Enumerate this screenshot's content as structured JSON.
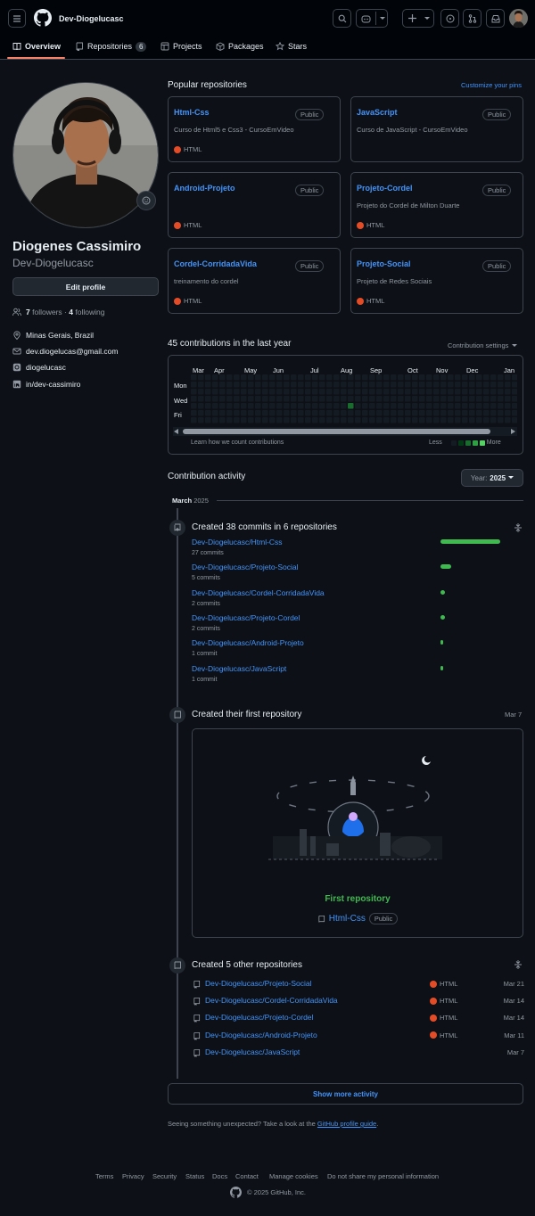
{
  "header": {
    "username": "Dev-Diogelucasc"
  },
  "tabs": [
    {
      "label": "Overview"
    },
    {
      "label": "Repositories",
      "count": "6"
    },
    {
      "label": "Projects"
    },
    {
      "label": "Packages"
    },
    {
      "label": "Stars"
    }
  ],
  "profile": {
    "name": "Diogenes Cassimiro",
    "login": "Dev-Diogelucasc",
    "edit_label": "Edit profile",
    "followers": "7",
    "followers_label": "followers",
    "following": "4",
    "following_label": "following",
    "location": "Minas Gerais, Brazil",
    "email": "dev.diogelucas@gmail.com",
    "instagram": "diogelucasc",
    "linkedin": "in/dev-cassimiro"
  },
  "pinned": {
    "title": "Popular repositories",
    "customize": "Customize your pins",
    "public_label": "Public",
    "items": [
      {
        "name": "Html-Css",
        "desc": "Curso de Html5 e Css3 - CursoEmVideo",
        "lang": "HTML"
      },
      {
        "name": "JavaScript",
        "desc": "Curso de JavaScript - CursoEmVideo",
        "lang": ""
      },
      {
        "name": "Android-Projeto",
        "desc": "",
        "lang": "HTML"
      },
      {
        "name": "Projeto-Cordel",
        "desc": "Projeto do Cordel de Milton Duarte",
        "lang": "HTML"
      },
      {
        "name": "Cordel-CorridadaVida",
        "desc": "treinamento do cordel",
        "lang": "HTML"
      },
      {
        "name": "Projeto-Social",
        "desc": "Projeto de Redes Sociais",
        "lang": "HTML"
      }
    ]
  },
  "contrib": {
    "title": "45 contributions in the last year",
    "settings": "Contribution settings",
    "months": [
      "Mar",
      "Apr",
      "May",
      "Jun",
      "Jul",
      "Aug",
      "Sep",
      "Oct",
      "Nov",
      "Dec",
      "Jan"
    ],
    "days": [
      "Mon",
      "Wed",
      "Fri"
    ],
    "learn": "Learn how we count contributions",
    "less": "Less",
    "more": "More"
  },
  "activity": {
    "title": "Contribution activity",
    "year_label": "Year:",
    "year": "2025",
    "month": "March",
    "month_year": "2025",
    "commits_title": "Created 38 commits in 6 repositories",
    "commits": [
      {
        "repo": "Dev-Diogelucasc/Html-Css",
        "count": "27 commits",
        "share": 0.71
      },
      {
        "repo": "Dev-Diogelucasc/Projeto-Social",
        "count": "5 commits",
        "share": 0.13
      },
      {
        "repo": "Dev-Diogelucasc/Cordel-CorridadaVida",
        "count": "2 commits",
        "share": 0.05
      },
      {
        "repo": "Dev-Diogelucasc/Projeto-Cordel",
        "count": "2 commits",
        "share": 0.05
      },
      {
        "repo": "Dev-Diogelucasc/Android-Projeto",
        "count": "1 commit",
        "share": 0.03
      },
      {
        "repo": "Dev-Diogelucasc/JavaScript",
        "count": "1 commit",
        "share": 0.03
      }
    ],
    "first_title": "Created their first repository",
    "first_date": "Mar 7",
    "first_label": "First repository",
    "first_repo": "Html-Css",
    "first_public": "Public",
    "other_title": "Created 5 other repositories",
    "others": [
      {
        "repo": "Dev-Diogelucasc/Projeto-Social",
        "lang": "HTML",
        "date": "Mar 21"
      },
      {
        "repo": "Dev-Diogelucasc/Cordel-CorridadaVida",
        "lang": "HTML",
        "date": "Mar 14"
      },
      {
        "repo": "Dev-Diogelucasc/Projeto-Cordel",
        "lang": "HTML",
        "date": "Mar 14"
      },
      {
        "repo": "Dev-Diogelucasc/Android-Projeto",
        "lang": "HTML",
        "date": "Mar 11"
      },
      {
        "repo": "Dev-Diogelucasc/JavaScript",
        "lang": "",
        "date": "Mar 7"
      }
    ],
    "show_more": "Show more activity",
    "unexpected": "Seeing something unexpected? Take a look at the",
    "guide": "GitHub profile guide",
    "guide_end": "."
  },
  "footer": {
    "links": [
      "Terms",
      "Privacy",
      "Security",
      "Status",
      "Docs",
      "Contact",
      "Manage cookies",
      "Do not share my personal information"
    ],
    "copyright": "© 2025 GitHub, Inc."
  },
  "colors": {
    "bg": "#0d1117",
    "accent": "#4493f8",
    "green": "#3fb950",
    "html": "#e34c26",
    "underline": "#f78166"
  }
}
